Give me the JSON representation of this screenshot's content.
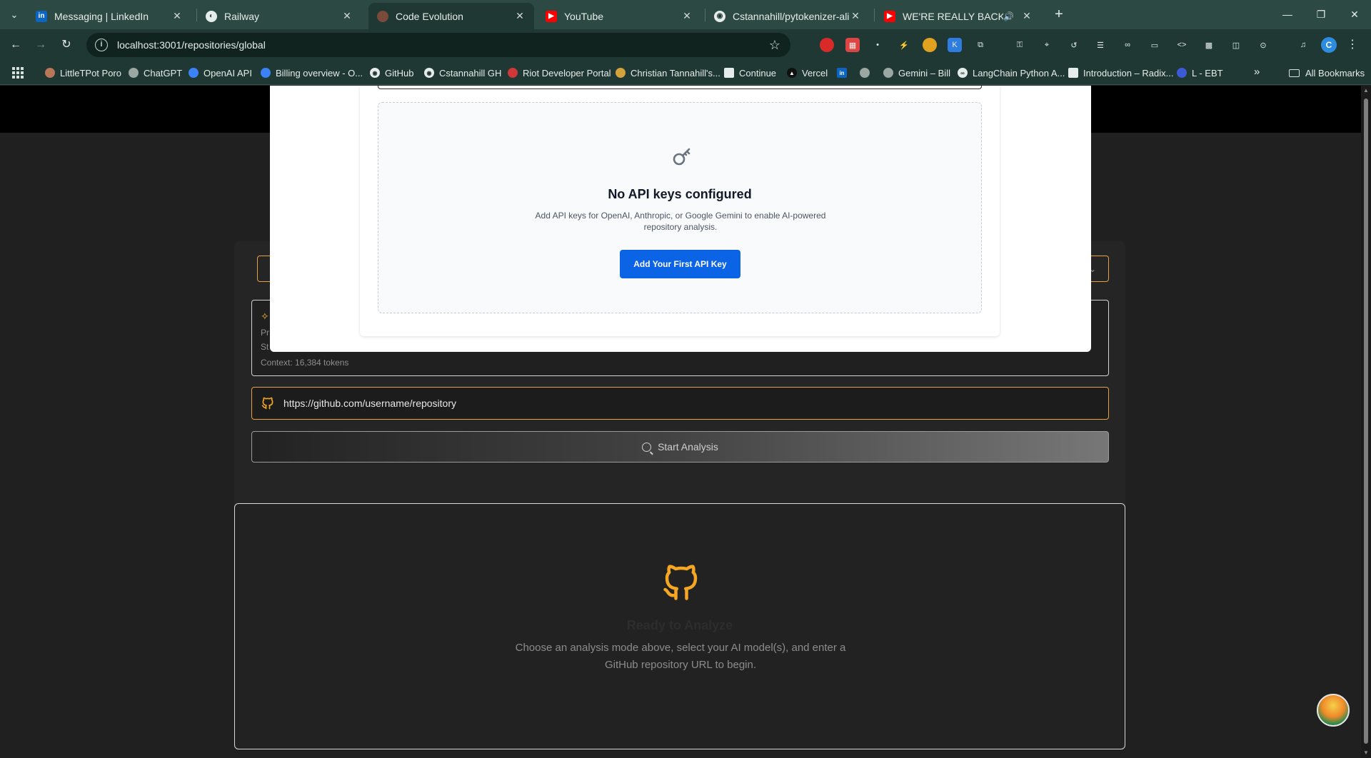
{
  "browser": {
    "tabs": [
      {
        "title": "Messaging | LinkedIn",
        "icon": "linkedin-icon",
        "color": "#0a66c2"
      },
      {
        "title": "Railway",
        "icon": "railway-icon",
        "color": "#c9d3d0"
      },
      {
        "title": "Code Evolution",
        "icon": "code-evolution-icon",
        "color": "#7a4a3a"
      },
      {
        "title": "YouTube",
        "icon": "youtube-icon",
        "color": "#ff0000"
      },
      {
        "title": "Cstannahill/pytokenizer-aligner",
        "icon": "github-icon",
        "color": "#e6ece9"
      },
      {
        "title": "WE'RE REALLY BACK NOW!",
        "icon": "youtube-icon",
        "color": "#ff0000"
      }
    ],
    "active_tab_index": 2,
    "address": "localhost:3001/repositories/global",
    "bookmarks": [
      {
        "label": "LittleTPot Poro",
        "icon": "poro-icon",
        "color": "#b9775a"
      },
      {
        "label": "ChatGPT",
        "icon": "chatgpt-icon",
        "color": "#9aa7a3"
      },
      {
        "label": "OpenAI API",
        "icon": "openai-icon",
        "color": "#3b82f6"
      },
      {
        "label": "Billing overview - O...",
        "icon": "openai-icon",
        "color": "#3b82f6"
      },
      {
        "label": "GitHub",
        "icon": "github-icon",
        "color": "#e6ece9"
      },
      {
        "label": "Cstannahill GH",
        "icon": "github-icon",
        "color": "#e6ece9"
      },
      {
        "label": "Riot Developer Portal",
        "icon": "riot-icon",
        "color": "#d13639"
      },
      {
        "label": "Christian Tannahill's...",
        "icon": "site-icon",
        "color": "#d4a23a"
      },
      {
        "label": "Continue",
        "icon": "continue-icon",
        "color": "#e6ece9"
      },
      {
        "label": "Vercel",
        "icon": "vercel-icon",
        "color": "#111111"
      },
      {
        "label": "",
        "icon": "linkedin-icon",
        "color": "#0a66c2"
      },
      {
        "label": "",
        "icon": "globe-icon",
        "color": "#9aa7a3"
      },
      {
        "label": "Gemini – Bill",
        "icon": "gemini-icon",
        "color": "#9aa7a3"
      },
      {
        "label": "LangChain Python A...",
        "icon": "langchain-icon",
        "color": "#e6ece9"
      },
      {
        "label": "Introduction – Radix...",
        "icon": "radix-icon",
        "color": "#e6ece9"
      },
      {
        "label": "L - EBT",
        "icon": "ebt-icon",
        "color": "#3b5bd6"
      }
    ],
    "all_bookmarks_label": "All Bookmarks",
    "profile_initial": "C"
  },
  "page": {
    "modal": {
      "empty_title": "No API keys configured",
      "empty_description": "Add API keys for OpenAI, Anthropic, or Google Gemini to enable AI-powered repository analysis.",
      "add_button_label": "Add Your First API Key"
    },
    "model_card": {
      "frag_1": "Pr",
      "frag_2": "St",
      "context_label": "Context: 16,384 tokens"
    },
    "repo_input": {
      "placeholder": "https://github.com/username/repository"
    },
    "start_button_label": "Start Analysis",
    "results": {
      "title": "Ready to Analyze",
      "hint": "Choose an analysis mode above, select your AI model(s), and enter a GitHub repository URL to begin."
    }
  },
  "colors": {
    "accent": "#f5a623",
    "primary_button": "#0b63e5",
    "chrome": "#1f3833"
  }
}
